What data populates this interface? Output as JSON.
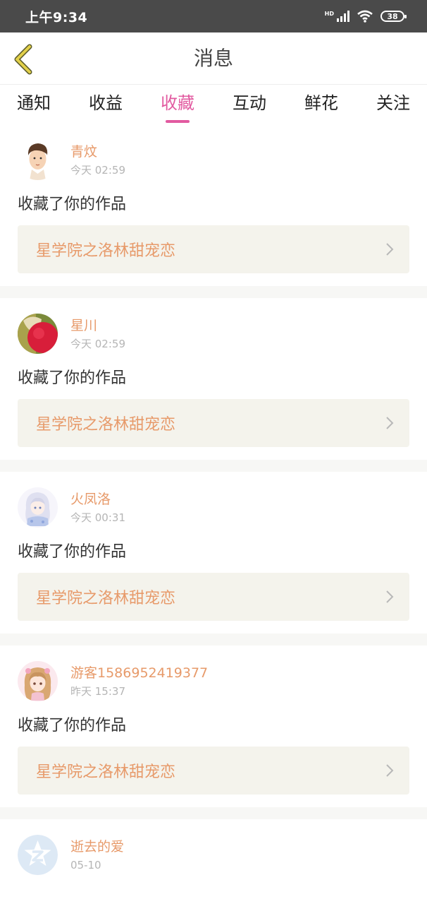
{
  "status": {
    "time": "上午9:34",
    "battery": "38",
    "hd": "HD"
  },
  "nav": {
    "title": "消息"
  },
  "tabs": [
    "通知",
    "收益",
    "收藏",
    "互动",
    "鲜花",
    "关注"
  ],
  "active_tab": 2,
  "messages": [
    {
      "name": "青炆",
      "time": "今天 02:59",
      "action": "收藏了你的作品",
      "work": "星学院之洛林甜宠恋"
    },
    {
      "name": "星川",
      "time": "今天 02:59",
      "action": "收藏了你的作品",
      "work": "星学院之洛林甜宠恋"
    },
    {
      "name": "火凤洛",
      "time": "今天 00:31",
      "action": "收藏了你的作品",
      "work": "星学院之洛林甜宠恋"
    },
    {
      "name": "游客1586952419377",
      "time": "昨天 15:37",
      "action": "收藏了你的作品",
      "work": "星学院之洛林甜宠恋"
    },
    {
      "name": "逝去的爱",
      "time": "05-10"
    }
  ],
  "colors": {
    "accent": "#e25aa0",
    "name": "#e79a6a",
    "back_arrow": "#c9b93a",
    "statusbar": "#4a4a4a"
  }
}
